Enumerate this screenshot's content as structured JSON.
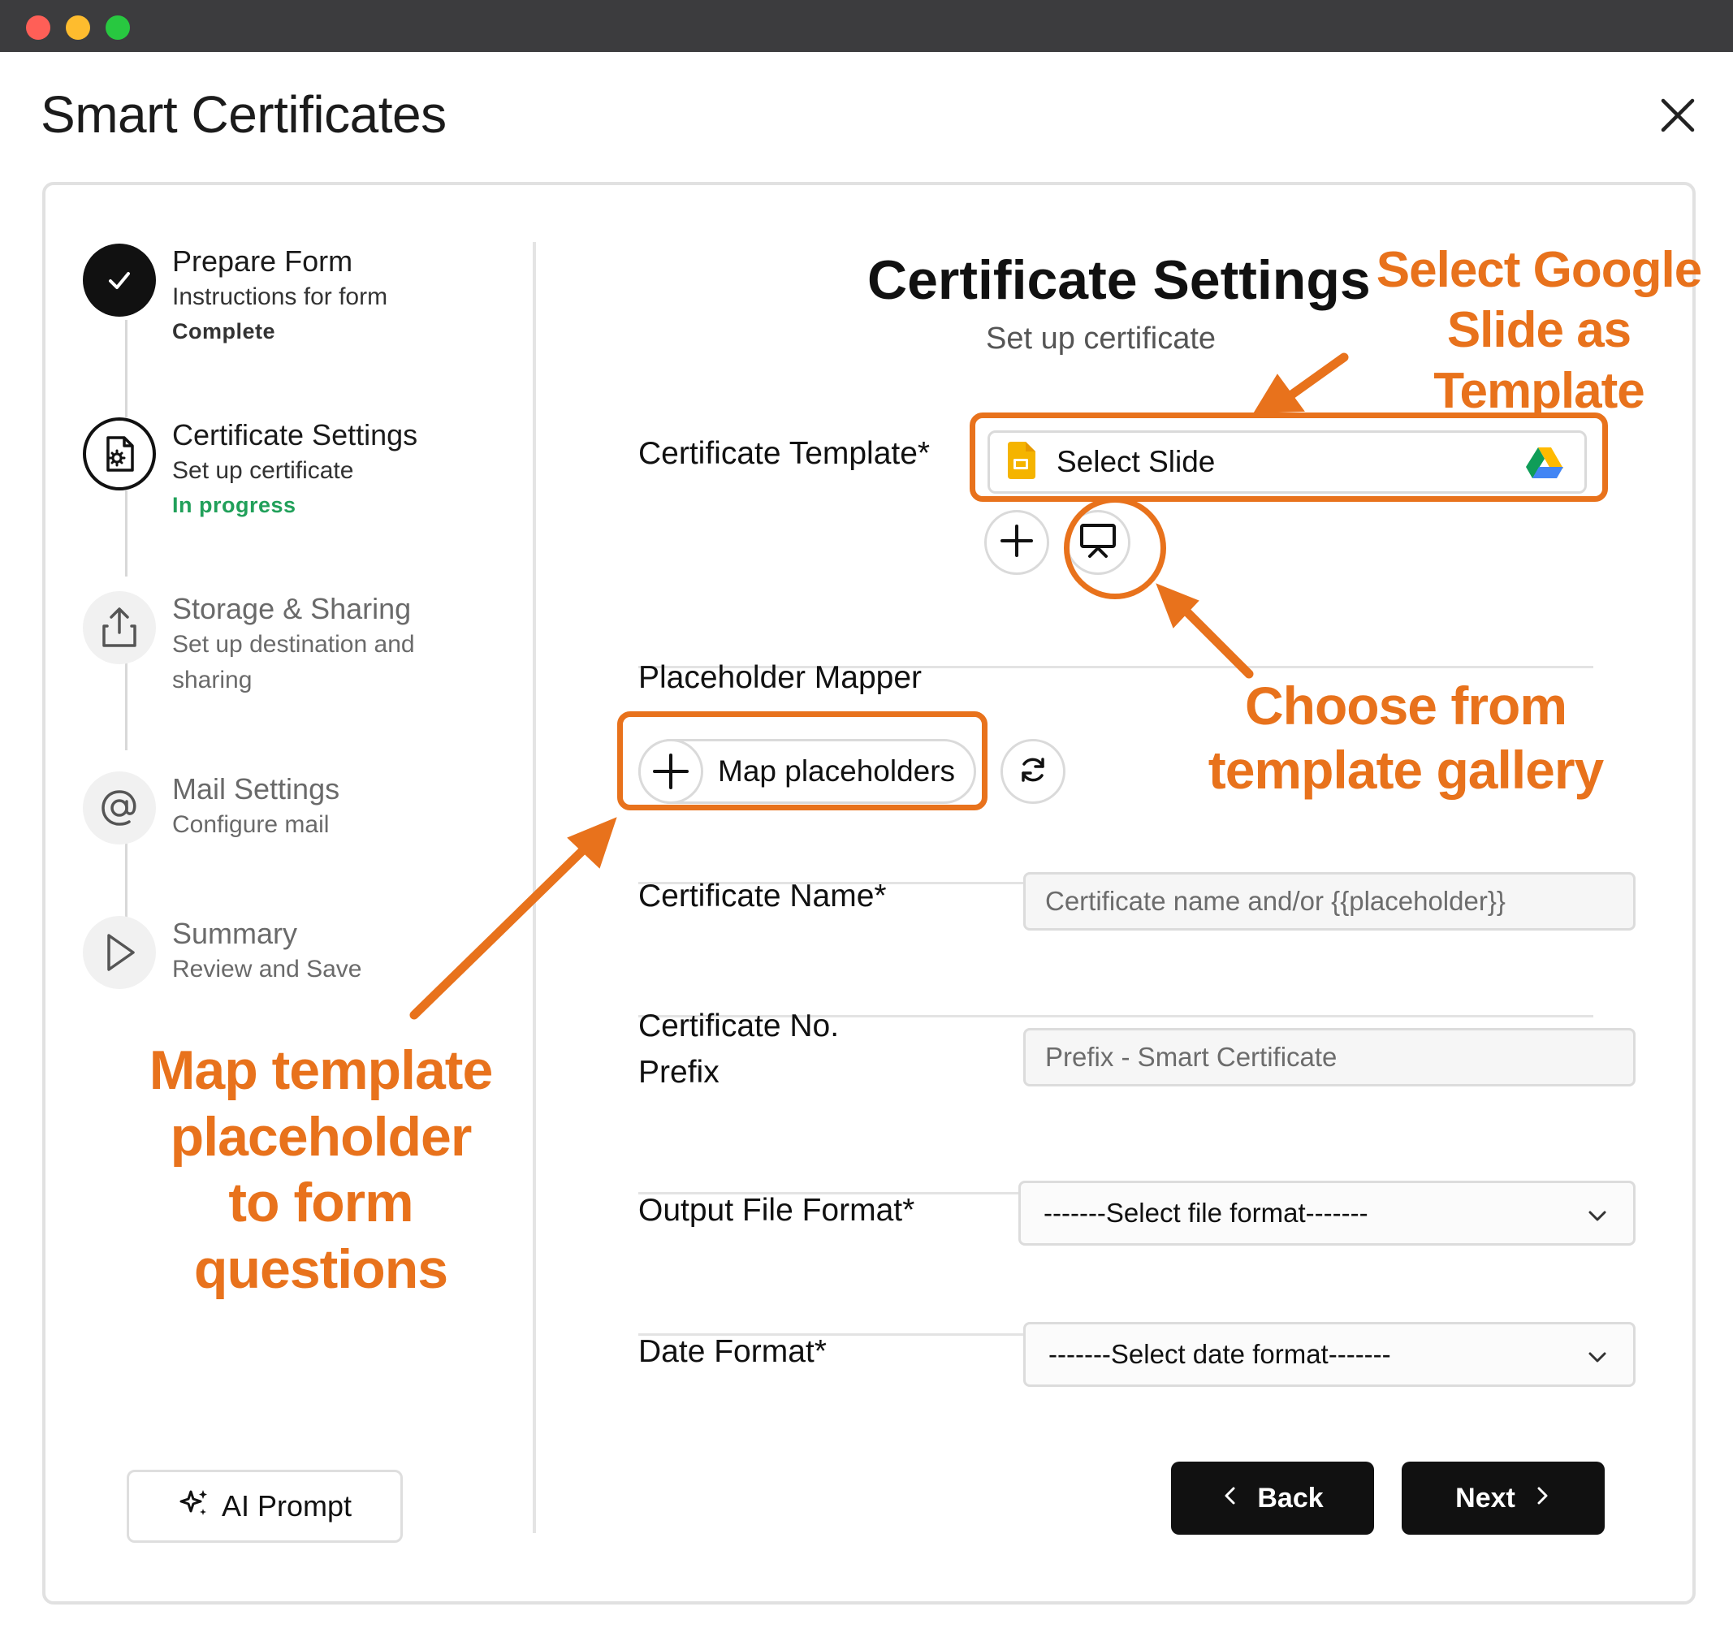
{
  "app": {
    "title": "Smart Certificates"
  },
  "sidebar": {
    "steps": [
      {
        "title": "Prepare Form",
        "subtitle": "Instructions for form",
        "status": "Complete"
      },
      {
        "title": "Certificate Settings",
        "subtitle": "Set up certificate",
        "status": "In progress"
      },
      {
        "title": "Storage & Sharing",
        "subtitle": "Set up destination and sharing"
      },
      {
        "title": "Mail Settings",
        "subtitle": "Configure mail"
      },
      {
        "title": "Summary",
        "subtitle": "Review and Save"
      }
    ],
    "ai_prompt_label": "AI Prompt"
  },
  "main": {
    "title": "Certificate Settings",
    "subtitle": "Set up certificate",
    "template": {
      "label": "Certificate Template*",
      "select_label": "Select Slide"
    },
    "placeholder_mapper": {
      "label": "Placeholder Mapper",
      "button_label": "Map placeholders"
    },
    "cert_name": {
      "label": "Certificate Name*",
      "placeholder": "Certificate name and/or {{placeholder}}"
    },
    "cert_prefix": {
      "label_line1": "Certificate No.",
      "label_line2": "Prefix",
      "placeholder": "Prefix - Smart Certificate"
    },
    "output_format": {
      "label": "Output File Format*",
      "value": "-------Select file format-------"
    },
    "date_format": {
      "label": "Date Format*",
      "value": "-------Select date format-------"
    },
    "back_label": "Back",
    "next_label": "Next"
  },
  "annotations": {
    "select_google": [
      "Select Google",
      "Slide as Template"
    ],
    "choose_gallery": [
      "Choose from",
      "template gallery"
    ],
    "map_template": [
      "Map template",
      "placeholder",
      "to form questions"
    ]
  },
  "colors": {
    "accent_orange": "#e8721c",
    "status_green": "#21a05a",
    "button_dark": "#111111"
  }
}
